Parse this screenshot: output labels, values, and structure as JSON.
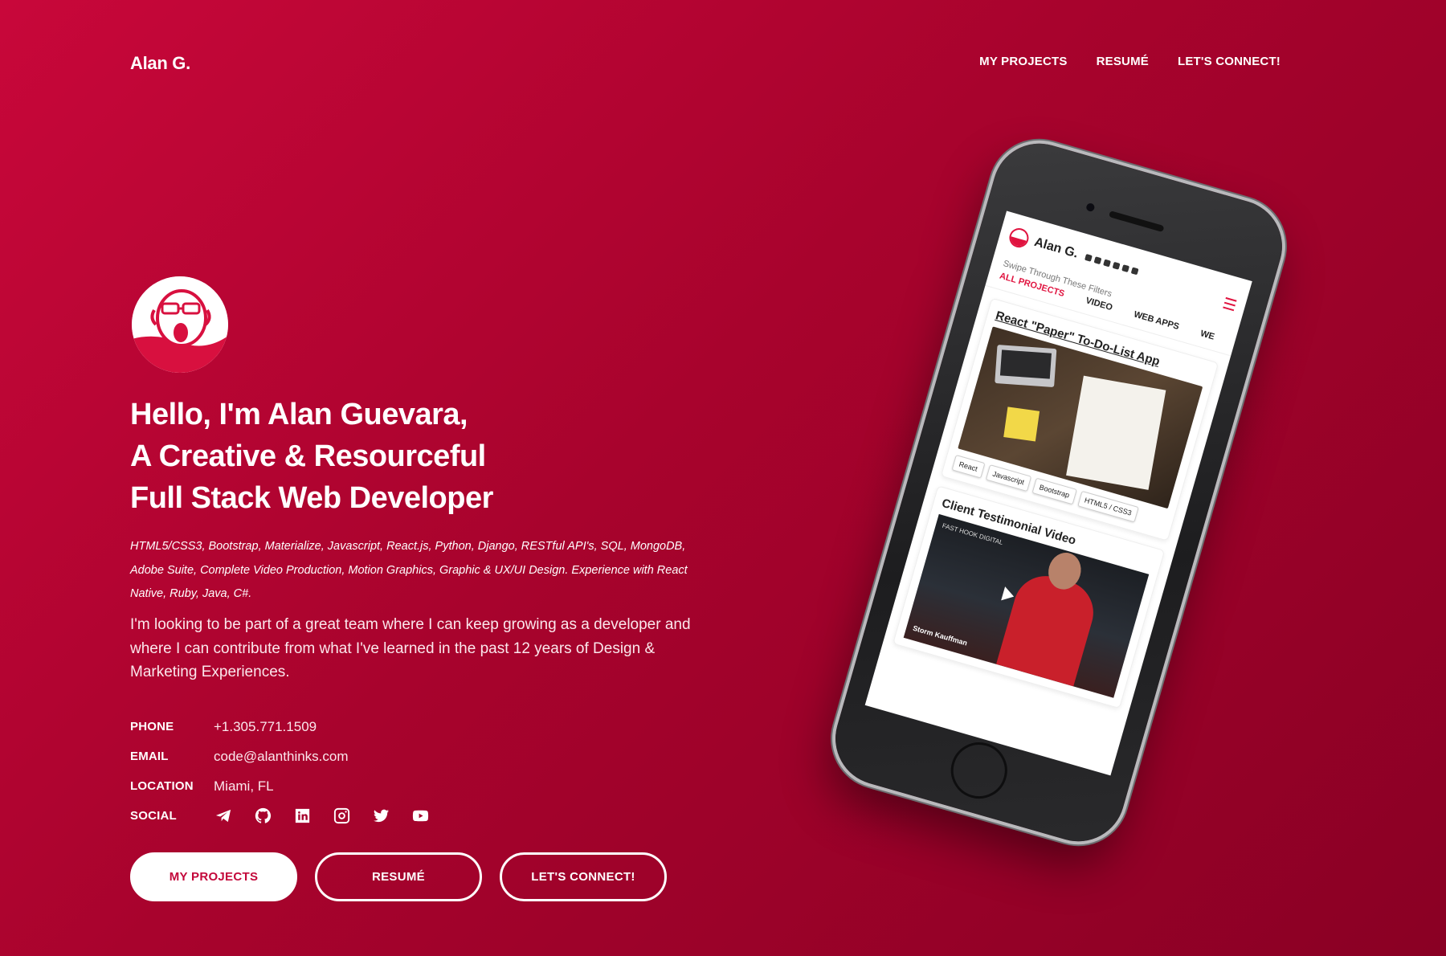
{
  "header": {
    "brand": "Alan G.",
    "nav": [
      "MY PROJECTS",
      "RESUMÉ",
      "LET'S CONNECT!"
    ]
  },
  "hero": {
    "headline": [
      "Hello, I'm Alan Guevara,",
      "A Creative & Resourceful",
      "Full Stack Web Developer"
    ],
    "skills": "HTML5/CSS3, Bootstrap, Materialize, Javascript, React.js, Python, Django, RESTful API's, SQL, MongoDB, Adobe Suite, Complete Video Production, Motion Graphics, Graphic & UX/UI Design. Experience with React Native, Ruby, Java, C#.",
    "intro": "I'm looking to be part of a great team where I can keep growing as a developer and where I can contribute from what I've learned in the past 12 years of Design & Marketing Experiences."
  },
  "info": {
    "phone_label": "PHONE",
    "phone": "+1.305.771.1509",
    "email_label": "EMAIL",
    "email": "code@alanthinks.com",
    "location_label": "LOCATION",
    "location": "Miami, FL",
    "social_label": "SOCIAL",
    "social_icons": [
      "telegram-icon",
      "github-icon",
      "linkedin-icon",
      "instagram-icon",
      "twitter-icon",
      "youtube-icon"
    ]
  },
  "buttons": {
    "projects": "MY PROJECTS",
    "resume": "RESUMÉ",
    "connect": "LET'S CONNECT!"
  },
  "phone_mock": {
    "brand": "Alan G.",
    "swipe": "Swipe Through These Filters",
    "tabs": [
      "ALL PROJECTS",
      "VIDEO",
      "WEB APPS",
      "WE"
    ],
    "card1_title": "React \"Paper\" To-Do-List App",
    "tags": [
      "React",
      "Javascript",
      "Bootstrap",
      "HTML5 / CSS3"
    ],
    "card2_title": "Client Testimonial Video",
    "video_label": "FAST HOOK DIGITAL",
    "video_person": "Storm Kauffman"
  },
  "colors": {
    "background_start": "#c8073a",
    "background_end": "#8a0024",
    "accent": "#e0133f",
    "text": "#ffffff"
  }
}
